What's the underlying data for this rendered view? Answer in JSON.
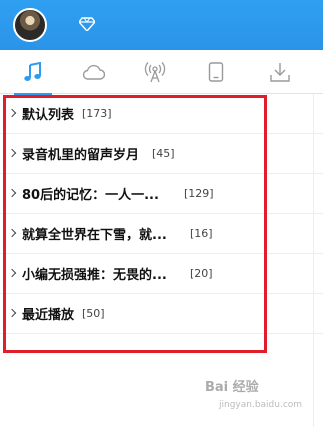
{
  "header": {
    "avatar_icon": "user-avatar",
    "vip_icon": "diamond-icon",
    "brand_color": "#2d9cf0"
  },
  "tabs": [
    {
      "icon": "music-note-icon",
      "active": true
    },
    {
      "icon": "cloud-icon",
      "active": false
    },
    {
      "icon": "radio-icon",
      "active": false
    },
    {
      "icon": "device-icon",
      "active": false
    },
    {
      "icon": "download-icon",
      "active": false
    }
  ],
  "playlists": [
    {
      "name": "默认列表",
      "count": "[173]"
    },
    {
      "name": "录音机里的留声岁月",
      "count": "[45]"
    },
    {
      "name": "80后的记忆：一人一...",
      "count": "[129]"
    },
    {
      "name": "就算全世界在下雪，就...",
      "count": "[16]"
    },
    {
      "name": "小编无损强推：无畏的...",
      "count": "[20]"
    },
    {
      "name": "最近播放",
      "count": "[50]"
    }
  ],
  "highlight_color": "#e01e2b",
  "watermark": {
    "logo": "Bai 经验",
    "sub": "jingyan.baidu.com"
  }
}
